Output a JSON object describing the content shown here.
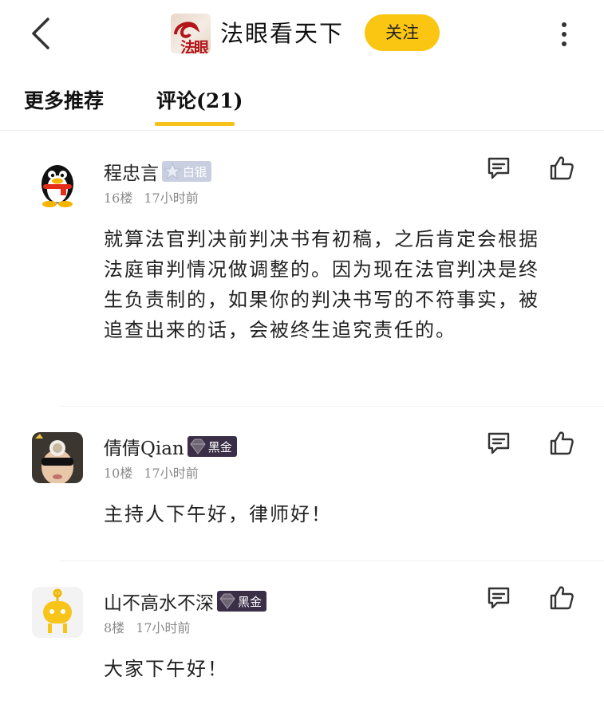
{
  "header": {
    "logo_text": "法眼",
    "channel_name": "法眼看天下",
    "follow_label": "关注"
  },
  "tabs": [
    {
      "label": "更多推荐",
      "active": false
    },
    {
      "label": "评论(21)",
      "active": true
    }
  ],
  "colors": {
    "accent": "#fbc612",
    "meta": "#8a8a8a",
    "divider": "#eeeeee"
  },
  "comments": [
    {
      "username": "程忠言",
      "badge": "白银",
      "floor": "16楼",
      "time": "17小时前",
      "text": "就算法官判决前判决书有初稿，之后肯定会根据法庭审判情况做调整的。因为现在法官判决是终生负责制的，如果你的判决书写的不符事实，被追查出来的话，会被终生追究责任的。"
    },
    {
      "username": "倩倩Qian",
      "badge": "黑金",
      "floor": "10楼",
      "time": "17小时前",
      "text": "主持人下午好，律师好！"
    },
    {
      "username": "山不高水不深",
      "badge": "黑金",
      "floor": "8楼",
      "time": "17小时前",
      "text": "大家下午好！"
    }
  ]
}
